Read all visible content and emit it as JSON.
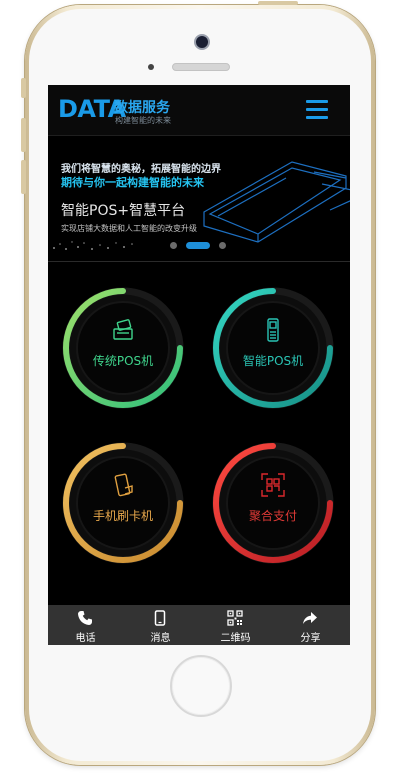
{
  "header": {
    "logo_text": "DATA",
    "logo_title": "数据服务",
    "logo_subtitle": "构建智能的未来",
    "menu_icon": "hamburger-menu-icon",
    "accent": "#1a9be8"
  },
  "banner": {
    "line1": "我们将智慧的奥秘，拓展智能的边界",
    "line2": "期待与你一起构建智能的未来",
    "title": "智能POS+智慧平台",
    "description": "实现店铺大数据和人工智能的改变升级",
    "slide_count": 3,
    "active_slide": 2
  },
  "tiles": [
    {
      "label": "传统POS机",
      "icon": "card-swipe-pos-icon",
      "color": "#3fd48c",
      "color2": "#9ee06a"
    },
    {
      "label": "智能POS机",
      "icon": "smart-pos-icon",
      "color": "#1fb5a8",
      "color2": "#34d6c2"
    },
    {
      "label": "手机刷卡机",
      "icon": "phone-card-icon",
      "color": "#e0a040",
      "color2": "#f0c060"
    },
    {
      "label": "聚合支付",
      "icon": "qr-scan-icon",
      "color": "#d9282c",
      "color2": "#ff4a40"
    }
  ],
  "bottom_nav": [
    {
      "label": "电话",
      "icon": "phone-icon"
    },
    {
      "label": "消息",
      "icon": "message-icon"
    },
    {
      "label": "二维码",
      "icon": "qr-code-icon"
    },
    {
      "label": "分享",
      "icon": "share-icon"
    }
  ]
}
